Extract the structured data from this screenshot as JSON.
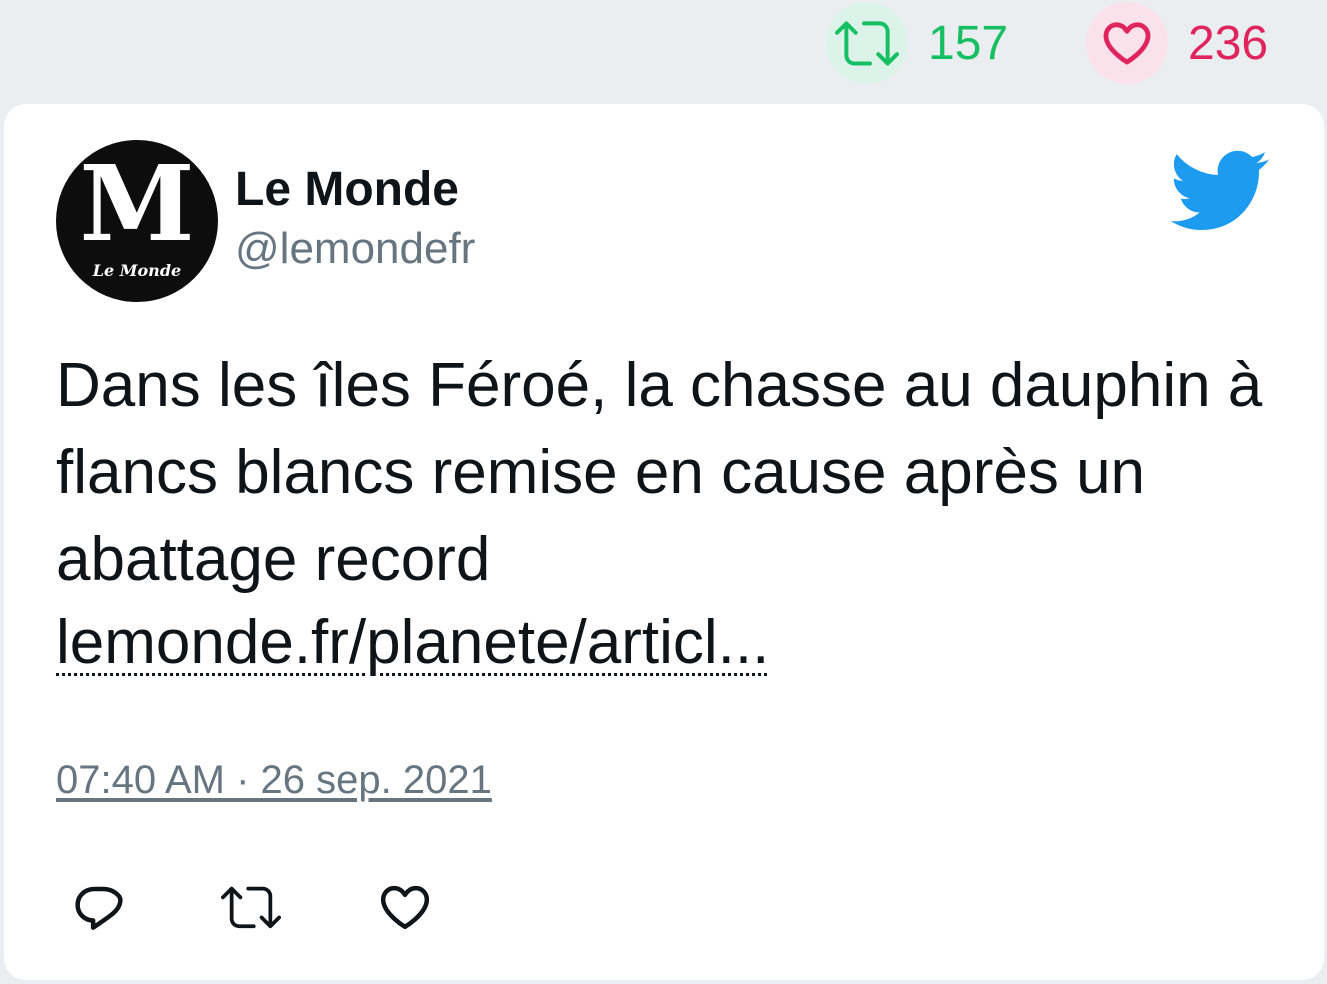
{
  "stats": {
    "retweets": "157",
    "likes": "236"
  },
  "author": {
    "name": "Le Monde",
    "handle": "@lemondefr",
    "avatar_logo": "M",
    "avatar_caption": "Le Monde"
  },
  "tweet": {
    "text": "Dans les îles Féroé, la chasse au dauphin à flancs blancs remise en cause après un abattage record",
    "link": "lemonde.fr/planete/articl...",
    "timestamp": "07:40 AM · 26 sep. 2021"
  },
  "icons": {
    "retweet": "retweet-icon",
    "like": "heart-icon",
    "brand": "twitter-bird-icon",
    "reply": "reply-icon"
  },
  "colors": {
    "retweet": "#17bf63",
    "like": "#e0245e",
    "twitter_blue": "#1d9bf0",
    "muted": "#66757f"
  }
}
